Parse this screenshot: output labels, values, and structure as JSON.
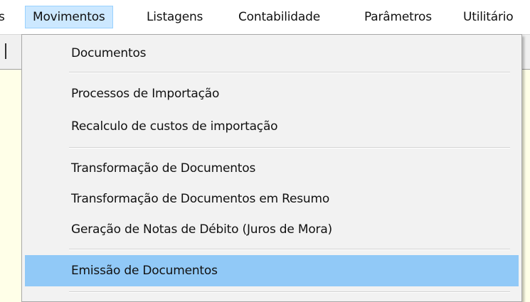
{
  "menubar": {
    "items": [
      {
        "label": "s"
      },
      {
        "label": "Movimentos"
      },
      {
        "label": "Listagens"
      },
      {
        "label": "Contabilidade"
      },
      {
        "label": "Parâmetros"
      },
      {
        "label": "Utilitário"
      }
    ]
  },
  "dropdown": {
    "items": [
      {
        "label": "Documentos"
      },
      {
        "label": "Processos de Importação"
      },
      {
        "label": "Recalculo de custos de importação"
      },
      {
        "label": "Transformação de Documentos"
      },
      {
        "label": "Transformação de Documentos em Resumo"
      },
      {
        "label": "Geração de Notas de Débito (Juros de Mora)"
      },
      {
        "label": "Emissão de Documentos"
      }
    ]
  },
  "colors": {
    "menubar_active_bg": "#cce8ff",
    "menu_highlight_bg": "#91c9f7",
    "workspace_bg": "#ffffe8"
  }
}
